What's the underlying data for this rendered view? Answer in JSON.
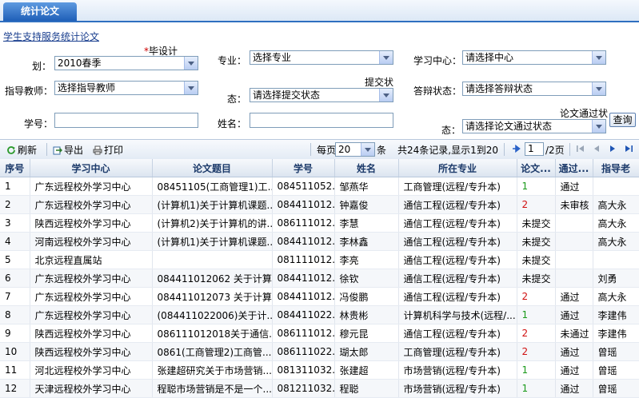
{
  "tab": "统计论文",
  "breadcrumb": "学生支持服务统计论文",
  "filters": {
    "req_mark": "*",
    "plan_label_a": "毕设计",
    "plan_label_b": "划：",
    "plan_value": "2010春季",
    "major_label": "专业：",
    "major_value": "选择专业",
    "center_label": "学习中心：",
    "center_value": "请选择中心",
    "teacher_label": "指导教师：",
    "teacher_value": "选择指导教师",
    "submit_label_a": "提交状",
    "submit_label_b": "态：",
    "submit_value": "请选择提交状态",
    "defense_label": "答辩状态：",
    "defense_value": "请选择答辩状态",
    "id_label": "学号：",
    "name_label": "姓名：",
    "pass_label_a": "论文通过状",
    "pass_label_b": "态：",
    "pass_value": "请选择论文通过状态",
    "query_button": "查询"
  },
  "toolbar": {
    "refresh": "刷新",
    "export": "导出",
    "print": "打印",
    "per_page_prefix": "每页",
    "per_page_value": "20",
    "per_page_suffix": "条",
    "summary": "共24条记录,显示1到20",
    "page_value": "1",
    "page_total": "/2页"
  },
  "table": {
    "headers": [
      "序号",
      "学习中心",
      "论文题目",
      "学号",
      "姓名",
      "所在专业",
      "论文...",
      "通过...",
      "指导老"
    ],
    "rows": [
      [
        "1",
        "广东远程校外学习中心",
        "08451105(工商管理1)工...",
        "084511052...",
        "邹燕华",
        "工商管理(远程/专升本)",
        "1",
        "通过",
        ""
      ],
      [
        "2",
        "广东远程校外学习中心",
        "(计算机1)关于计算机课题...",
        "084411012...",
        "钟嘉俊",
        "通信工程(远程/专升本)",
        "2",
        "未审核",
        "高大永"
      ],
      [
        "3",
        "陕西远程校外学习中心",
        "(计算机2)关于计算机的讲...",
        "086111012...",
        "李慧",
        "通信工程(远程/专升本)",
        "未提交",
        "",
        "高大永"
      ],
      [
        "4",
        "河南远程校外学习中心",
        "(计算机1)关于计算机课题...",
        "084411012...",
        "李林鑫",
        "通信工程(远程/专升本)",
        "未提交",
        "",
        "高大永"
      ],
      [
        "5",
        "北京远程直属站",
        "",
        "081111012...",
        "李亮",
        "通信工程(远程/专升本)",
        "未提交",
        "",
        ""
      ],
      [
        "6",
        "广东远程校外学习中心",
        "084411012062 关于计算...",
        "084411012...",
        "徐钦",
        "通信工程(远程/专升本)",
        "未提交",
        "",
        "刘勇"
      ],
      [
        "7",
        "广东远程校外学习中心",
        "084411012073 关于计算...",
        "084411012...",
        "冯俊鹏",
        "通信工程(远程/专升本)",
        "2",
        "通过",
        "高大永"
      ],
      [
        "8",
        "广东远程校外学习中心",
        "(084411022006)关于计...",
        "084411022...",
        "林贵彬",
        "计算机科学与技术(远程/...",
        "1",
        "通过",
        "李建伟"
      ],
      [
        "9",
        "陕西远程校外学习中心",
        "086111012018关于通信...",
        "086111012...",
        "穆元昆",
        "通信工程(远程/专升本)",
        "2",
        "未通过",
        "李建伟"
      ],
      [
        "10",
        "陕西远程校外学习中心",
        "0861(工商管理2)工商管...",
        "086111022...",
        "瑚太郎",
        "工商管理(远程/专升本)",
        "2",
        "通过",
        "曾瑶"
      ],
      [
        "11",
        "河北远程校外学习中心",
        "张建超研究关于市场营销...",
        "081311032...",
        "张建超",
        "市场营销(远程/专升本)",
        "1",
        "通过",
        "曾瑶"
      ],
      [
        "12",
        "天津远程校外学习中心",
        "程聪市场营销是不是一个...",
        "081211032...",
        "程聪",
        "市场营销(远程/专升本)",
        "1",
        "通过",
        "曾瑶"
      ]
    ],
    "count_colors": {
      "1": "green",
      "2": "red"
    }
  }
}
